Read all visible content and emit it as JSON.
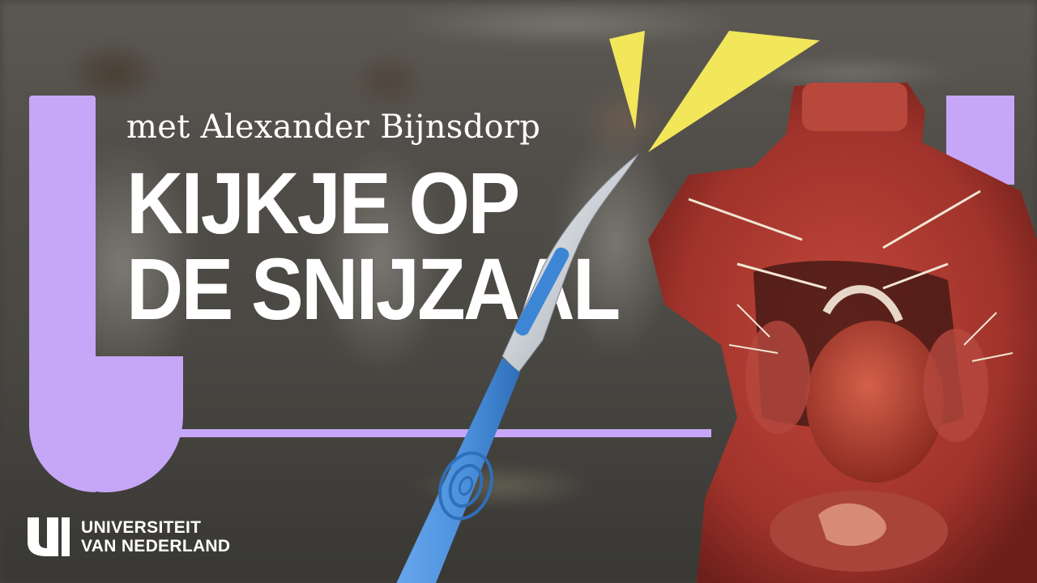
{
  "subtitle": "met Alexander Bijnsdorp",
  "title": {
    "line1": "KIJKJE OP",
    "line2": "DE SNIJZAAL"
  },
  "logo": {
    "line1": "UNIVERSITEIT",
    "line2": "VAN NEDERLAND",
    "icon": "u-logo-icon"
  },
  "colors": {
    "frame": "#c6a6f6",
    "burst": "#f2e65a",
    "scalpel_handle": "#4a8fdc",
    "title_text": "#ffffff"
  }
}
